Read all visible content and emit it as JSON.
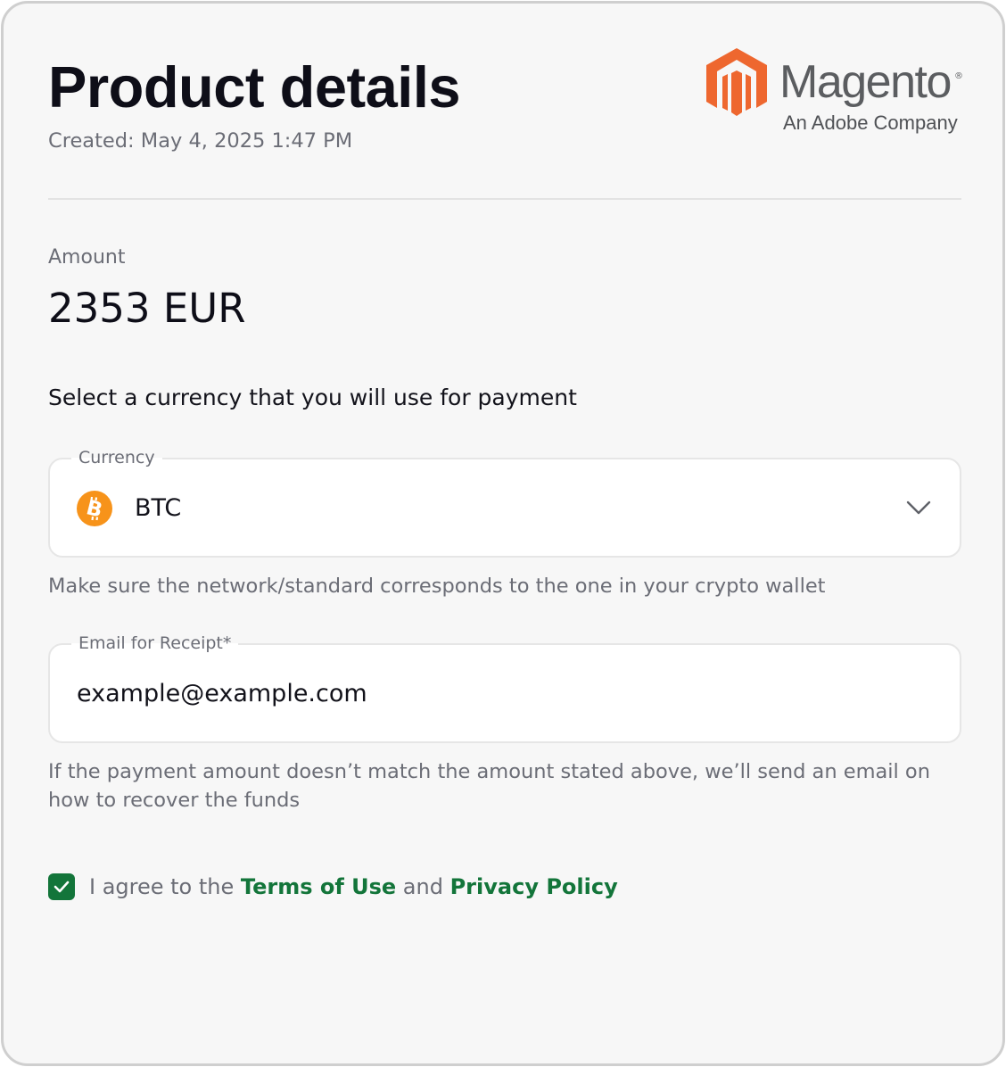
{
  "header": {
    "title": "Product details",
    "created": "Created: May 4, 2025 1:47 PM"
  },
  "brand": {
    "name": "Magento",
    "registered": "®",
    "tagline": "An Adobe Company",
    "mark_icon": "magento-logo-icon",
    "mark_color": "#ee672f"
  },
  "amount": {
    "label": "Amount",
    "value": "2353 EUR"
  },
  "currency_section": {
    "prompt": "Select a currency that you will use for payment",
    "field_label": "Currency",
    "selected_value": "BTC",
    "selected_icon": "bitcoin-icon",
    "icon_color": "#f7931a",
    "dropdown_icon": "chevron-down-icon",
    "helper": "Make sure the network/standard corresponds to the one in your crypto wallet"
  },
  "email_section": {
    "field_label": "Email for Receipt*",
    "value": "example@example.com",
    "helper": "If the payment amount doesn’t match the amount stated above, we’ll send an email on how to recover the funds"
  },
  "agreement": {
    "checked": true,
    "prefix": "I agree to the ",
    "terms_link": "Terms of Use",
    "conjunction": " and ",
    "privacy_link": "Privacy Policy",
    "accent_color": "#13753a"
  }
}
